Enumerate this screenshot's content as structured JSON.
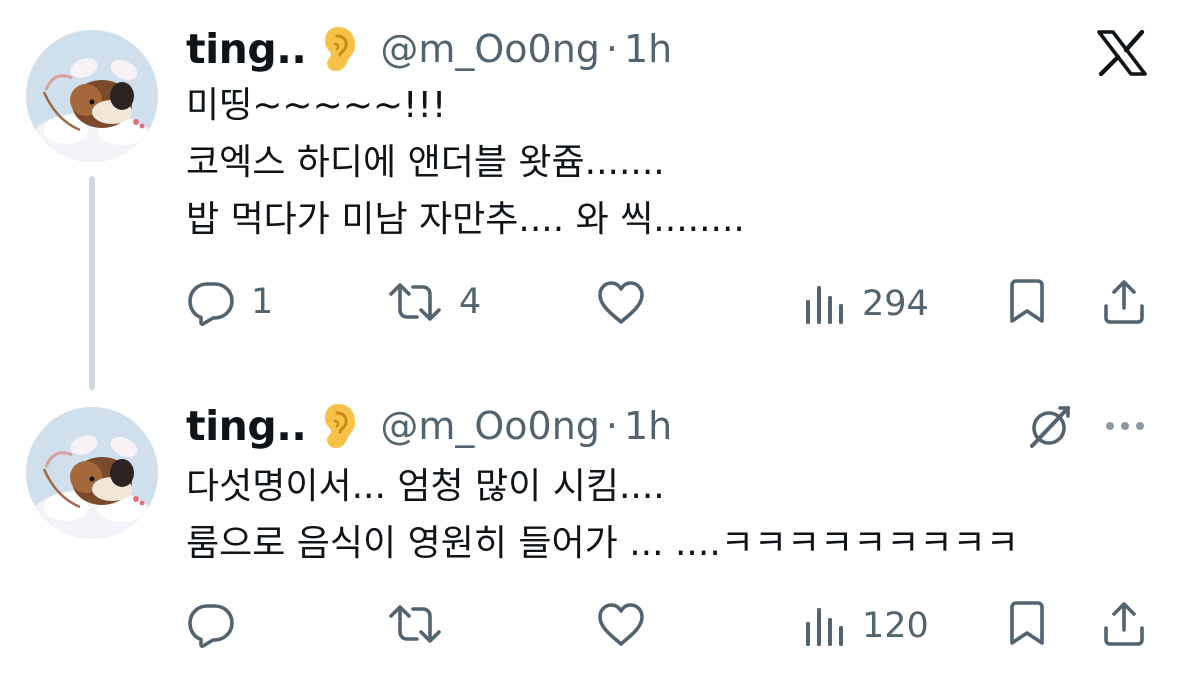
{
  "tweets": [
    {
      "author": {
        "display_name": "ting..",
        "badge_icon": "ear-emoji",
        "handle": "@m_Oo0ng",
        "separator": "·",
        "time": "1h"
      },
      "lines": [
        "미띵~~~~~!!!",
        "코엑스 하디에 앤더블 왓쥼.......",
        "밥 먹다가 미남 자만추.... 와 씩........"
      ],
      "actions": {
        "replies": "1",
        "reposts": "4",
        "likes": "",
        "views": "294"
      }
    },
    {
      "author": {
        "display_name": "ting..",
        "badge_icon": "ear-emoji",
        "handle": "@m_Oo0ng",
        "separator": "·",
        "time": "1h"
      },
      "lines": [
        "다섯명이서... 엄청 많이 시킴....",
        "룸으로 음식이 영원히 들어가 ... ....ㅋㅋㅋㅋㅋㅋㅋㅋㅋ"
      ],
      "actions": {
        "replies": "",
        "reposts": "",
        "likes": "",
        "views": "120"
      }
    }
  ],
  "icons": {
    "brand": "x-logo",
    "grok": "grok-icon",
    "more": "more-dots-icon",
    "reply": "reply-icon",
    "repost": "repost-icon",
    "like": "heart-icon",
    "views": "views-icon",
    "bookmark": "bookmark-icon",
    "share": "share-icon"
  },
  "colors": {
    "text": "#0f1419",
    "secondary": "#536471",
    "thread_line": "#cfd9de"
  }
}
